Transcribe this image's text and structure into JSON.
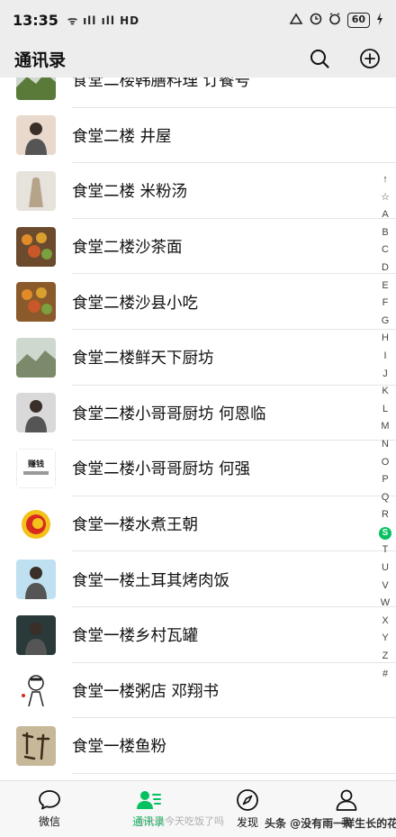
{
  "status": {
    "time": "13:35",
    "signal": "ᯤ ıll ıll HD",
    "battery": "60"
  },
  "header": {
    "title": "通讯录"
  },
  "contacts": [
    {
      "label": "食堂二楼韩膳料理 订餐号",
      "avatar_color": "#5a7a3a",
      "avatar_icon": "landscape"
    },
    {
      "label": "食堂二楼 井屋",
      "avatar_color": "#e9d8cc",
      "avatar_icon": "person"
    },
    {
      "label": "食堂二楼 米粉汤",
      "avatar_color": "#b5a48a",
      "avatar_icon": "statue"
    },
    {
      "label": "食堂二楼沙茶面",
      "avatar_color": "#6b4a2e",
      "avatar_icon": "food"
    },
    {
      "label": "食堂二楼沙县小吃",
      "avatar_color": "#8a5a2a",
      "avatar_icon": "food"
    },
    {
      "label": "食堂二楼鲜天下厨坊",
      "avatar_color": "#7a8a6a",
      "avatar_icon": "landscape"
    },
    {
      "label": "食堂二楼小哥哥厨坊 何恩临",
      "avatar_color": "#d9d9d9",
      "avatar_icon": "person"
    },
    {
      "label": "食堂二楼小哥哥厨坊 何强",
      "avatar_color": "#ffffff",
      "avatar_icon": "logo-text",
      "avatar_text": "赚钱"
    },
    {
      "label": "食堂一楼水煮王朝",
      "avatar_color": "#ffffff",
      "avatar_icon": "logo-circle"
    },
    {
      "label": "食堂一楼土耳其烤肉饭",
      "avatar_color": "#bfe0f0",
      "avatar_icon": "person"
    },
    {
      "label": "食堂一楼乡村瓦罐",
      "avatar_color": "#2a3a3a",
      "avatar_icon": "person"
    },
    {
      "label": "食堂一楼粥店 邓翔书",
      "avatar_color": "#ffffff",
      "avatar_icon": "cartoon"
    },
    {
      "label": "食堂一楼鱼粉",
      "avatar_color": "#c8b89a",
      "avatar_icon": "calligraphy"
    }
  ],
  "index_letters": [
    "↑",
    "☆",
    "A",
    "B",
    "C",
    "D",
    "E",
    "F",
    "G",
    "H",
    "I",
    "J",
    "K",
    "L",
    "M",
    "N",
    "O",
    "P",
    "Q",
    "R",
    "S",
    "T",
    "U",
    "V",
    "W",
    "X",
    "Y",
    "Z",
    "#"
  ],
  "index_active": "S",
  "tabs": [
    {
      "label": "微信",
      "icon": "chat-icon"
    },
    {
      "label": "通讯录",
      "icon": "contacts-icon",
      "active": true
    },
    {
      "label": "发现",
      "icon": "compass-icon"
    },
    {
      "label": "我",
      "icon": "profile-icon"
    }
  ],
  "watermarks": {
    "left": "@永水今天吃饭了吗",
    "right": "头条 @没有雨一样生长的花"
  },
  "colors": {
    "accent": "#07c160"
  }
}
